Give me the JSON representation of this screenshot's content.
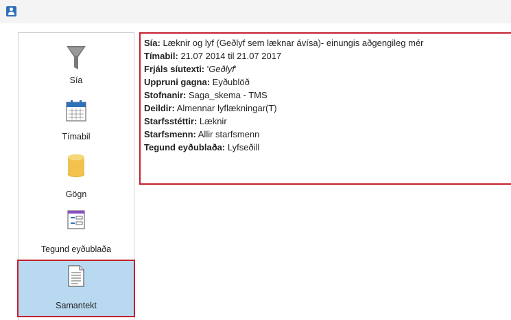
{
  "app": {
    "icon": "person-icon"
  },
  "sidebar": {
    "items": [
      {
        "label": "Sía",
        "icon": "filter-funnel-icon"
      },
      {
        "label": "Tímabil",
        "icon": "calendar-icon"
      },
      {
        "label": "Gögn",
        "icon": "database-cylinder-icon"
      },
      {
        "label": "Tegund eyðublaða",
        "icon": "form-type-icon"
      },
      {
        "label": "Samantekt",
        "icon": "document-icon",
        "active": true
      }
    ]
  },
  "summary": {
    "lines": [
      {
        "key": "Sía:",
        "value": " Læknir og lyf (Geðlyf sem læknar ávísa)- einungis aðgengileg mér"
      },
      {
        "key": "Tímabil:",
        "value": " 21.07 2014 til 21.07 2017"
      },
      {
        "key": "Frjáls síutexti:",
        "value_prefix": " '",
        "value_italic": "Geðlyf",
        "value_suffix": "'"
      },
      {
        "key": "Uppruni gagna:",
        "value": " Eyðublöð"
      },
      {
        "key": "Stofnanir:",
        "value": " Saga_skema - TMS"
      },
      {
        "key": "Deildir:",
        "value": " Almennar lyflækningar(T)"
      },
      {
        "key": "Starfsstéttir:",
        "value": " Læknir"
      },
      {
        "key": "Starfsmenn:",
        "value": " Allir starfsmenn"
      },
      {
        "key": "Tegund eyðublaða:",
        "value": " Lyfseðill"
      }
    ]
  },
  "colors": {
    "highlight_border": "#c51f2d",
    "active_bg": "#b9d9f1",
    "app_icon": "#2f71b8",
    "db_icon": "#f2c14e"
  }
}
